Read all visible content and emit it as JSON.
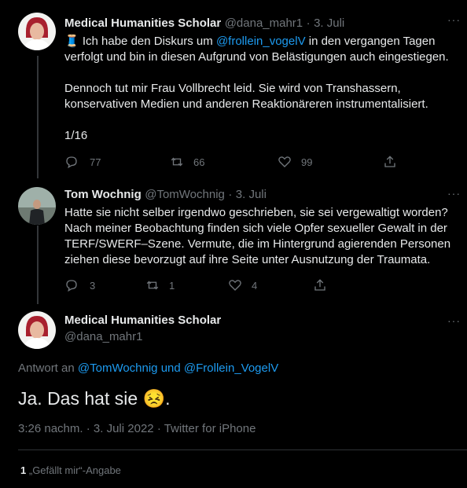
{
  "tweet1": {
    "name": "Medical Humanities Scholar",
    "handle": "@dana_mahr1",
    "sep": "·",
    "date": "3. Juli",
    "line1_emoji": "🧵",
    "line1_a": " Ich habe den Diskurs um ",
    "line1_mention": "@frollein_vogelV",
    "line1_b": " in den vergangen Tagen",
    "line2": "verfolgt und bin in diesen Aufgrund von Belästigungen auch eingestiegen.",
    "line3": "Dennoch tut mir Frau Vollbrecht leid. Sie wird von Transhassern,",
    "line4": "konservativen Medien und anderen Reaktionäreren instrumentalisiert.",
    "line5": "1/16",
    "replies": "77",
    "retweets": "66",
    "likes": "99"
  },
  "tweet2": {
    "name": "Tom Wochnig",
    "handle": "@TomWochnig",
    "sep": "·",
    "date": "3. Juli",
    "lines": [
      "Hatte sie nicht selber irgendwo geschrieben, sie sei vergewaltigt worden?",
      "Nach meiner Beobachtung finden sich viele Opfer sexueller Gewalt in der",
      "TERF/SWERF–Szene. Vermute, die im Hintergrund agierenden Personen",
      "ziehen diese bevorzugt auf ihre Seite unter Ausnutzung der Traumata."
    ],
    "replies": "3",
    "retweets": "1",
    "likes": "4"
  },
  "main": {
    "name": "Medical Humanities Scholar",
    "handle": "@dana_mahr1",
    "reply_prefix": "Antwort an ",
    "reply_mention1": "@TomWochnig",
    "reply_and": " und ",
    "reply_mention2": "@Frollein_VogelV",
    "text": "Ja. Das hat sie ",
    "text_end": ".",
    "emoji": "😣",
    "meta_time": "3:26 nachm.",
    "meta_sep1": "·",
    "meta_date": "3. Juli 2022",
    "meta_sep2": "·",
    "meta_source": "Twitter for iPhone",
    "likes_count": "1",
    "likes_label": "„Gefällt mir“-Angabe"
  },
  "more_glyph": "···",
  "colors": {
    "background": "#000000",
    "text": "#e7e9ea",
    "muted": "#71767b",
    "link": "#1d9bf0",
    "divider": "#2f3336"
  }
}
